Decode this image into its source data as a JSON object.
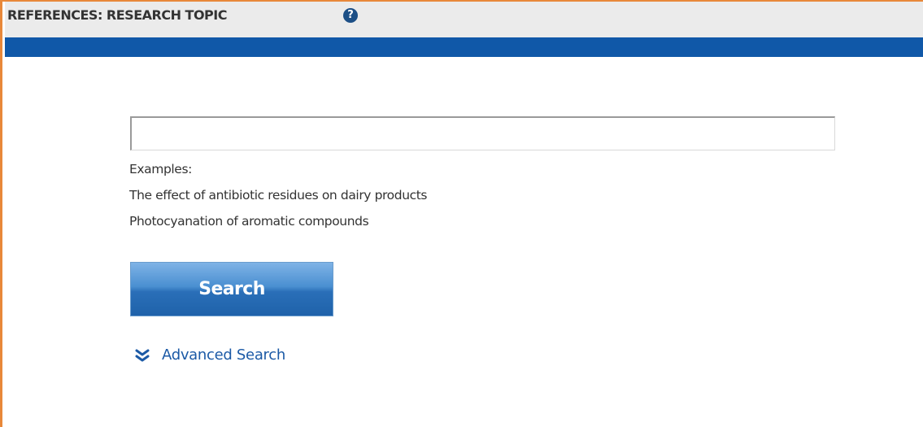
{
  "header": {
    "title": "REFERENCES: RESEARCH TOPIC",
    "help_icon": "?"
  },
  "search": {
    "value": "",
    "placeholder": "",
    "examples_label": "Examples:",
    "examples": [
      "The effect of antibiotic residues on dairy products",
      "Photocyanation of aromatic compounds"
    ],
    "button_label": "Search"
  },
  "advanced": {
    "label": "Advanced Search",
    "icon": "double-chevron-down-icon"
  },
  "colors": {
    "border": "#e8883a",
    "header_bar": "#1058a8",
    "link": "#1c5aa6",
    "button": "#2a6fb8"
  }
}
